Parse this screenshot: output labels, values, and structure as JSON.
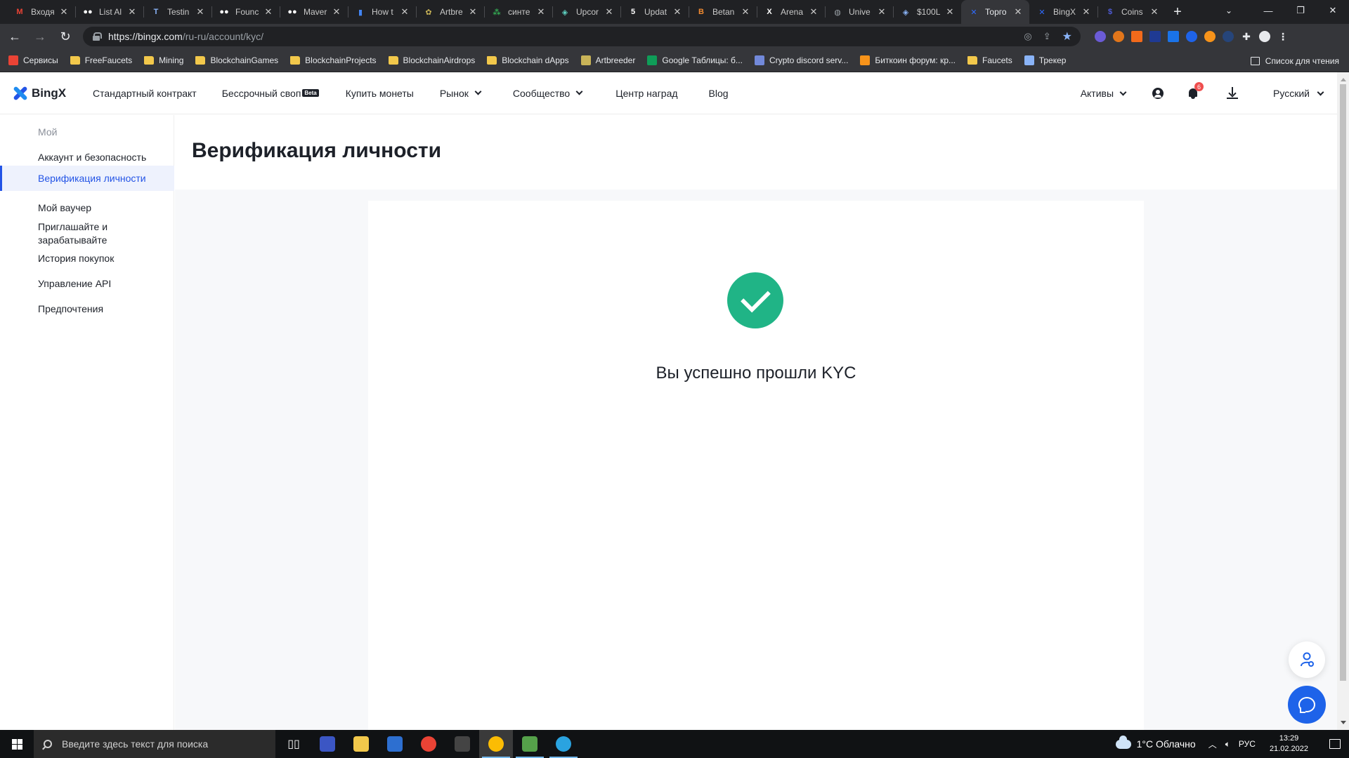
{
  "browser": {
    "tabs": [
      {
        "title": "Входя",
        "icon": "gmail-icon",
        "icon_text": "M",
        "icon_color": "#ea4335"
      },
      {
        "title": "List Al",
        "icon": "medium-icon",
        "icon_text": "●●",
        "icon_color": "#ffffff"
      },
      {
        "title": "Testin",
        "icon": "testnet-icon",
        "icon_text": "T",
        "icon_color": "#8ab4f8"
      },
      {
        "title": "Founc",
        "icon": "medium-icon",
        "icon_text": "●●",
        "icon_color": "#ffffff"
      },
      {
        "title": "Maver",
        "icon": "medium-icon",
        "icon_text": "●●",
        "icon_color": "#ffffff"
      },
      {
        "title": "How t",
        "icon": "chart-icon",
        "icon_text": "▮",
        "icon_color": "#4285f4"
      },
      {
        "title": "Artbre",
        "icon": "artbreeder-icon",
        "icon_text": "✿",
        "icon_color": "#c9b458"
      },
      {
        "title": "синте",
        "icon": "dots-icon",
        "icon_text": "⁂",
        "icon_color": "#34a853"
      },
      {
        "title": "Upcor",
        "icon": "shield-icon",
        "icon_text": "◈",
        "icon_color": "#5fd4c4"
      },
      {
        "title": "Updat",
        "icon": "five-icon",
        "icon_text": "5",
        "icon_color": "#ffffff"
      },
      {
        "title": "Betan",
        "icon": "betanet-icon",
        "icon_text": "B",
        "icon_color": "#f28b30"
      },
      {
        "title": "Arena",
        "icon": "arena-icon",
        "icon_text": "X",
        "icon_color": "#ffffff"
      },
      {
        "title": "Unive",
        "icon": "globe-icon",
        "icon_text": "◍",
        "icon_color": "#9aa0a6"
      },
      {
        "title": "$100L",
        "icon": "shield-icon",
        "icon_text": "◈",
        "icon_color": "#8ab4f8"
      },
      {
        "title": "Торго",
        "icon": "bingx-icon",
        "icon_text": "✕",
        "icon_color": "#2f6bff",
        "active": true
      },
      {
        "title": "BingX",
        "icon": "bingx-icon",
        "icon_text": "✕",
        "icon_color": "#2f6bff"
      },
      {
        "title": "Coins",
        "icon": "coin-icon",
        "icon_text": "$",
        "icon_color": "#4f5bd5"
      }
    ],
    "url_host": "https://bingx.com",
    "url_path": "/ru-ru/account/kyc/",
    "bookmarks": [
      {
        "label": "Сервисы",
        "icon": "apps-icon",
        "color": "#ea4335"
      },
      {
        "label": "FreeFaucets",
        "icon": "folder-icon",
        "color": "#f2c84b"
      },
      {
        "label": "Mining",
        "icon": "folder-icon",
        "color": "#f2c84b"
      },
      {
        "label": "BlockchainGames",
        "icon": "folder-icon",
        "color": "#f2c84b"
      },
      {
        "label": "BlockchainProjects",
        "icon": "folder-icon",
        "color": "#f2c84b"
      },
      {
        "label": "BlockchainAirdrops",
        "icon": "folder-icon",
        "color": "#f2c84b"
      },
      {
        "label": "Blockchain dApps",
        "icon": "folder-icon",
        "color": "#f2c84b"
      },
      {
        "label": "Artbreeder",
        "icon": "artbreeder-icon",
        "color": "#c9b458"
      },
      {
        "label": "Google Таблицы: б...",
        "icon": "sheets-icon",
        "color": "#0f9d58"
      },
      {
        "label": "Crypto discord serv...",
        "icon": "discord-icon",
        "color": "#7289da"
      },
      {
        "label": "Биткоин форум: кр...",
        "icon": "bitcoin-icon",
        "color": "#f7931a"
      },
      {
        "label": "Faucets",
        "icon": "folder-icon",
        "color": "#f2c84b"
      },
      {
        "label": "Трекер",
        "icon": "tracker-icon",
        "color": "#8ab4f8"
      }
    ],
    "reading_list": "Список для чтения"
  },
  "site_nav": {
    "logo": "BingX",
    "items": [
      {
        "label": "Стандартный контракт",
        "dropdown": false
      },
      {
        "label": "Бессрочный своп",
        "dropdown": false,
        "badge": "Beta"
      },
      {
        "label": "Купить монеты",
        "dropdown": false
      },
      {
        "label": "Рынок",
        "dropdown": true
      },
      {
        "label": "Сообщество",
        "dropdown": true
      },
      {
        "label": "Центр наград",
        "dropdown": false
      },
      {
        "label": "Blog",
        "dropdown": false
      }
    ],
    "assets": "Активы",
    "notification_count": "6",
    "language": "Русский"
  },
  "sidebar": {
    "items": [
      {
        "label": "Мой",
        "state": "muted",
        "top": 0
      },
      {
        "label": "Аккаунт и безопасность",
        "state": "normal"
      },
      {
        "label": "Верификация личности",
        "state": "active"
      },
      {
        "label": "Мой ваучер",
        "state": "normal"
      },
      {
        "label": "Приглашайте и зарабатывайте",
        "state": "normal"
      },
      {
        "label": "История покупок",
        "state": "normal"
      },
      {
        "label": "Управление API",
        "state": "normal"
      },
      {
        "label": "Предпочтения",
        "state": "normal"
      }
    ]
  },
  "main": {
    "title": "Верификация личности",
    "success_message": "Вы успешно прошли KYC"
  },
  "taskbar": {
    "search_placeholder": "Введите здесь текст для поиска",
    "weather": "1°C  Облачно",
    "language": "РУС",
    "time": "13:29",
    "date": "21.02.2022"
  },
  "colors": {
    "accent": "#2354e6",
    "success": "#20b486",
    "chat_button": "#1e63e9"
  }
}
